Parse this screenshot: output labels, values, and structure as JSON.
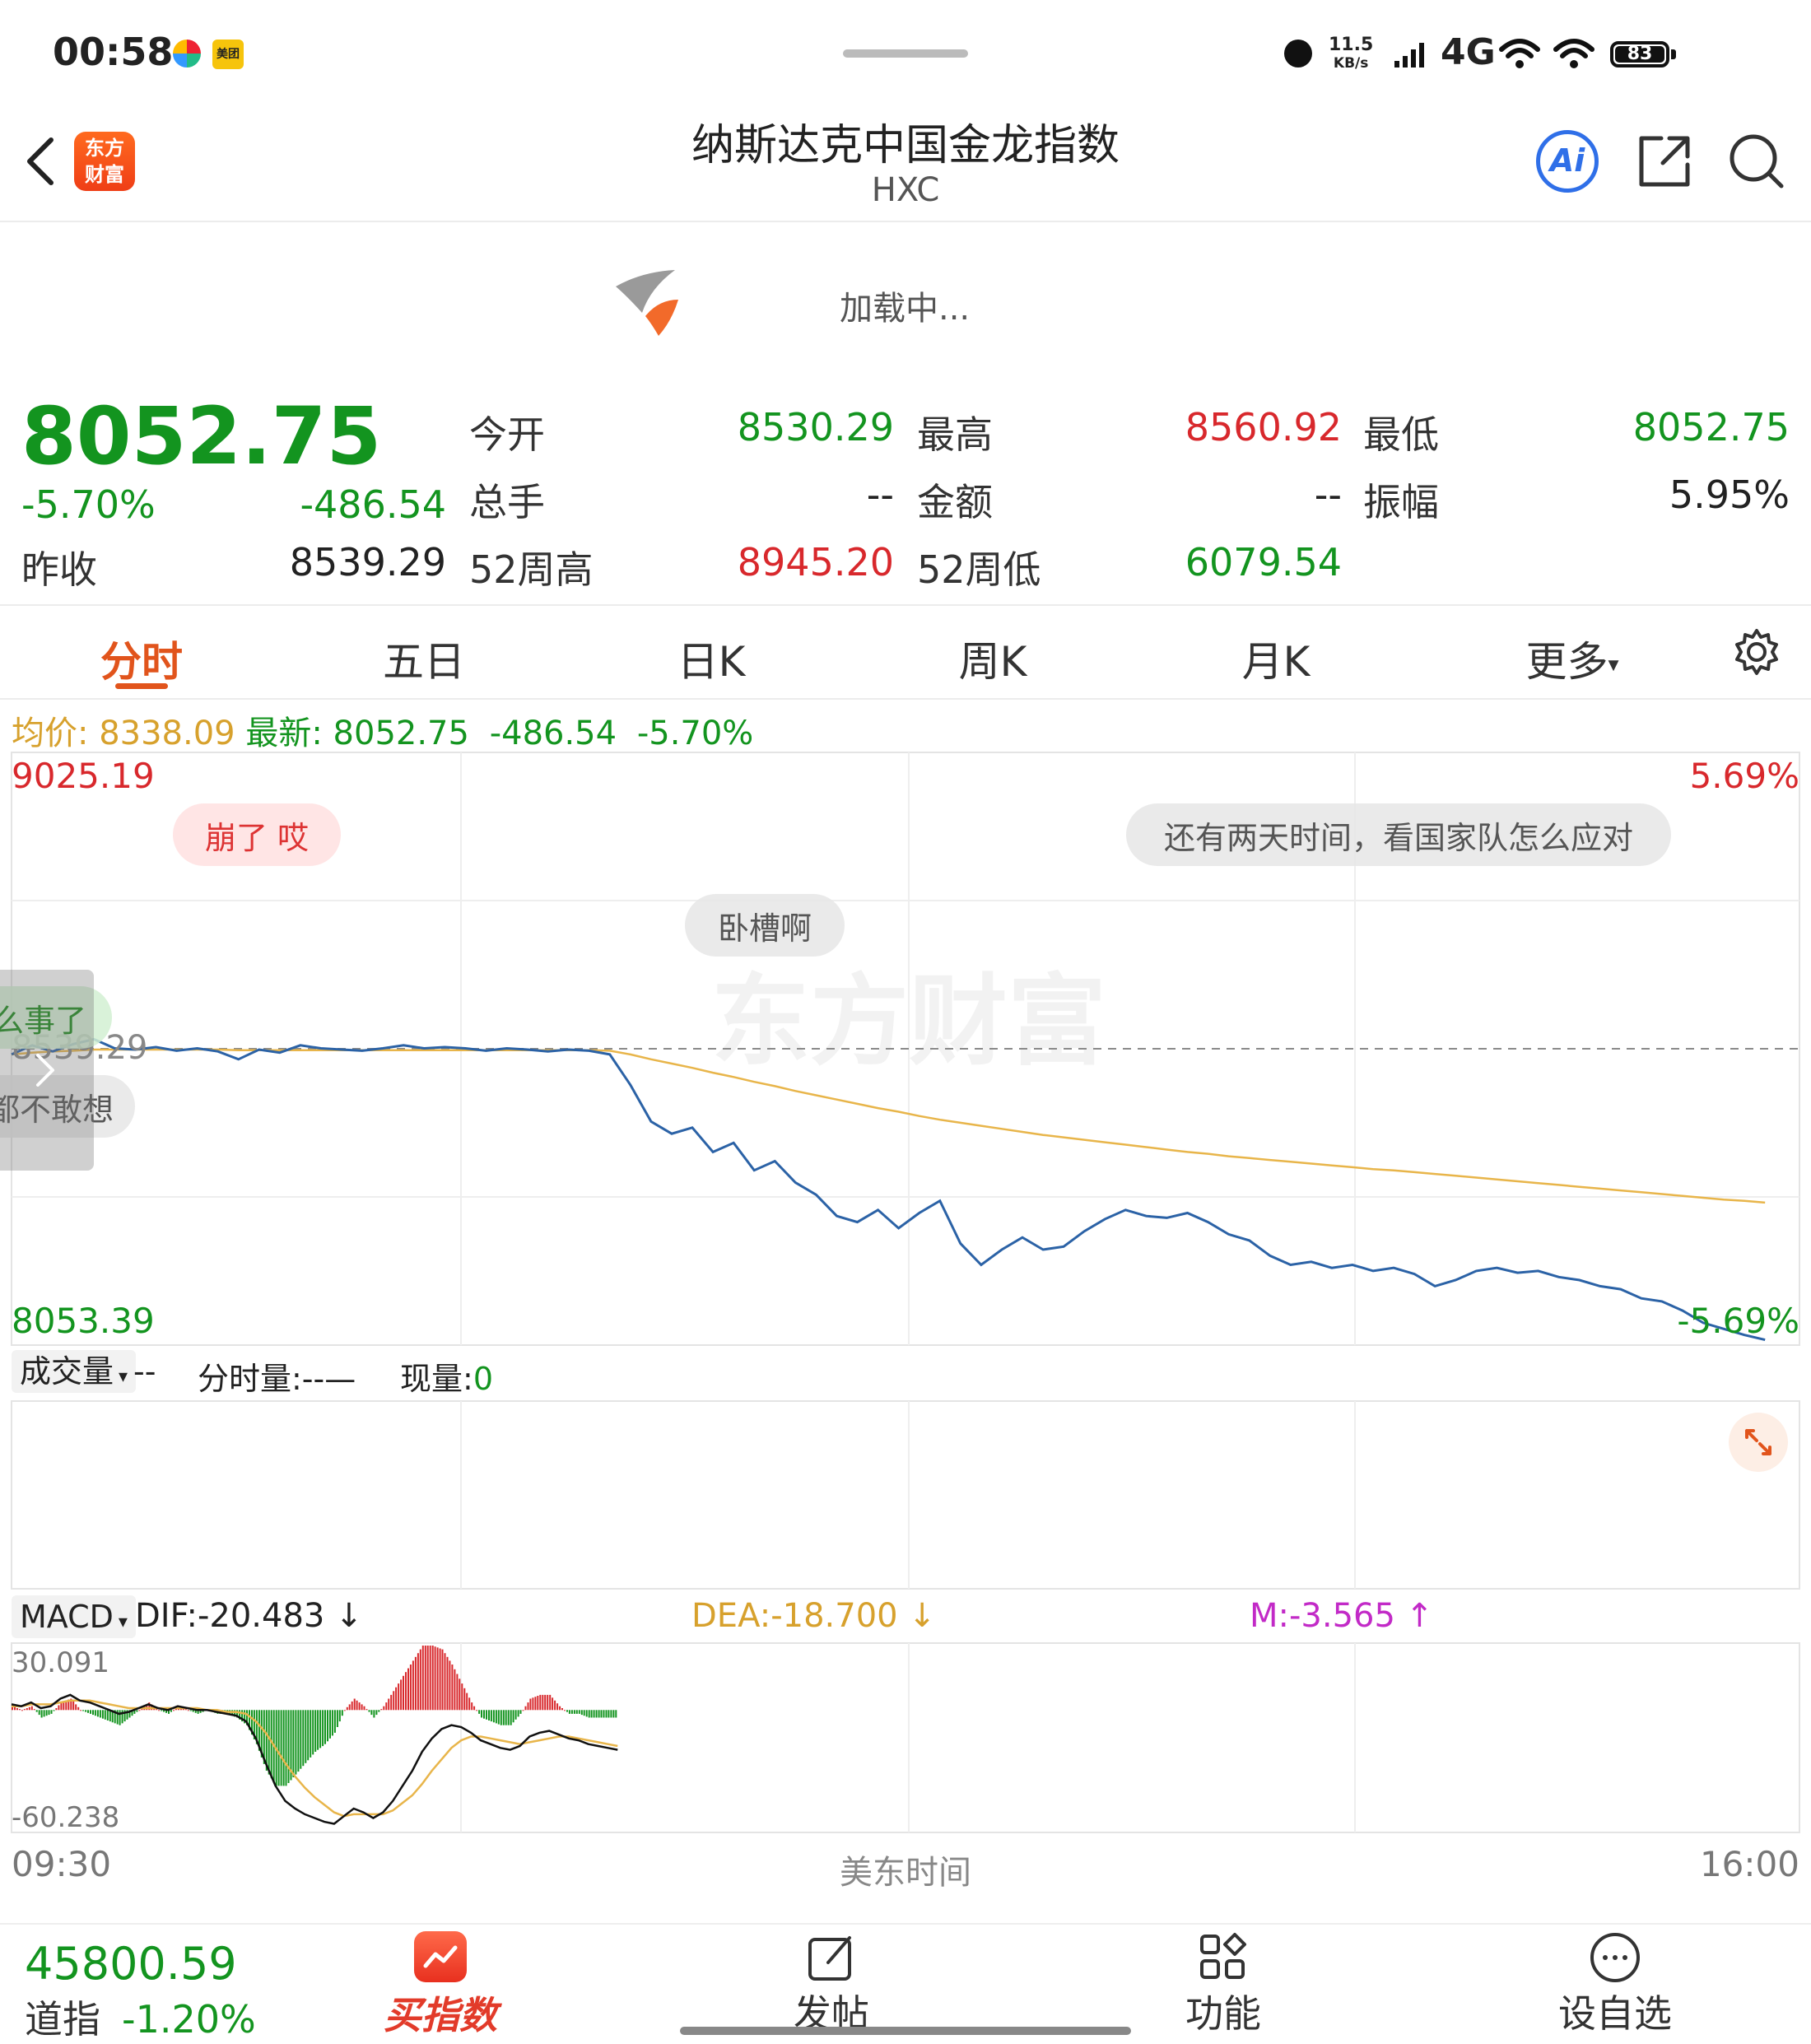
{
  "status": {
    "time": "00:58",
    "net_speed_value": "11.5",
    "net_speed_unit": "KB/s",
    "network": "4G",
    "battery": "83",
    "app_badge_text": "美团"
  },
  "header": {
    "title": "纳斯达克中国金龙指数",
    "subtitle": "HXC",
    "logo_text_1": "东方",
    "logo_text_2": "财富",
    "ai_label": "Ai"
  },
  "loading": {
    "text": "加载中..."
  },
  "quote": {
    "price": "8052.75",
    "change_pct": "-5.70%",
    "change": "-486.54",
    "prev_close_label": "昨收",
    "prev_close": "8539.29",
    "open_label": "今开",
    "open": "8530.29",
    "high_label": "最高",
    "high": "8560.92",
    "low_label": "最低",
    "low": "8052.75",
    "volume_label": "总手",
    "volume": "--",
    "amount_label": "金额",
    "amount": "--",
    "amplitude_label": "振幅",
    "amplitude": "5.95%",
    "wk52_high_label": "52周高",
    "wk52_high": "8945.20",
    "wk52_low_label": "52周低",
    "wk52_low": "6079.54"
  },
  "tabs": [
    {
      "label": "分时",
      "active": true
    },
    {
      "label": "五日"
    },
    {
      "label": "日K"
    },
    {
      "label": "周K"
    },
    {
      "label": "月K"
    },
    {
      "label": "更多"
    }
  ],
  "infoline": {
    "avg_label": "均价:",
    "avg": "8338.09",
    "latest_label": "最新:",
    "latest": "8052.75",
    "change": "-486.54",
    "pct": "-5.70%"
  },
  "chart_data": {
    "type": "line",
    "y_max": "9025.19",
    "y_min": "8053.39",
    "pct_max": "5.69%",
    "pct_min": "-5.69%",
    "ref_label": "8539.29",
    "ylim": [
      8053.39,
      9025.19
    ],
    "ref": 8539.29,
    "watermark": "东方财富",
    "series": [
      {
        "key": "price",
        "color": "#2b62a6",
        "values": [
          8530,
          8545,
          8535,
          8547,
          8555,
          8540,
          8538,
          8542,
          8536,
          8540,
          8535,
          8522,
          8538,
          8533,
          8545,
          8540,
          8538,
          8536,
          8540,
          8545,
          8540,
          8542,
          8540,
          8536,
          8540,
          8538,
          8535,
          8538,
          8536,
          8530,
          8480,
          8420,
          8400,
          8410,
          8370,
          8385,
          8340,
          8355,
          8320,
          8300,
          8265,
          8255,
          8275,
          8245,
          8270,
          8290,
          8220,
          8185,
          8210,
          8230,
          8210,
          8215,
          8240,
          8260,
          8275,
          8265,
          8262,
          8270,
          8255,
          8235,
          8225,
          8200,
          8185,
          8190,
          8180,
          8185,
          8175,
          8180,
          8170,
          8150,
          8160,
          8175,
          8180,
          8172,
          8175,
          8165,
          8160,
          8150,
          8145,
          8130,
          8125,
          8110,
          8090,
          8080,
          8070,
          8062
        ]
      },
      {
        "key": "avg",
        "color": "#e8b54a",
        "values": [
          8530,
          8533,
          8535,
          8536,
          8538,
          8538,
          8538,
          8538,
          8538,
          8538,
          8538,
          8537,
          8537,
          8537,
          8537,
          8537,
          8537,
          8537,
          8537,
          8537,
          8537,
          8537,
          8537,
          8537,
          8537,
          8537,
          8537,
          8537,
          8537,
          8536,
          8530,
          8522,
          8515,
          8508,
          8500,
          8493,
          8485,
          8478,
          8470,
          8463,
          8456,
          8449,
          8442,
          8436,
          8429,
          8423,
          8418,
          8413,
          8408,
          8403,
          8398,
          8394,
          8390,
          8386,
          8382,
          8378,
          8374,
          8370,
          8367,
          8363,
          8360,
          8357,
          8354,
          8351,
          8348,
          8345,
          8342,
          8340,
          8337,
          8334,
          8331,
          8328,
          8325,
          8322,
          8319,
          8316,
          8313,
          8310,
          8307,
          8304,
          8301,
          8298,
          8295,
          8292,
          8290,
          8287
        ]
      }
    ]
  },
  "danmaku": [
    "崩了 哎",
    "还有两天时间，看国家队怎么应对",
    "卧槽啊",
    "么事了",
    "都不敢想"
  ],
  "volume_panel": {
    "selector": "成交量",
    "dash": "--",
    "minute_volume": "分时量:--—",
    "current_label": "现量:",
    "current_value": "0"
  },
  "macd": {
    "selector": "MACD",
    "dif": "DIF:-20.483",
    "dea": "DEA:-18.700",
    "m": "M:-3.565",
    "y_max": "30.091",
    "y_min": "-60.238",
    "ylim": [
      -60.238,
      30.091
    ],
    "dif_values": [
      3,
      2,
      4,
      1,
      2,
      6,
      8,
      5,
      4,
      2,
      0,
      -2,
      -1,
      1,
      3,
      1,
      0,
      2,
      1,
      0,
      0,
      -1,
      -2,
      -3,
      -6,
      -15,
      -28,
      -40,
      -48,
      -52,
      -55,
      -57,
      -59,
      -60,
      -56,
      -52,
      -54,
      -57,
      -54,
      -48,
      -40,
      -32,
      -22,
      -15,
      -10,
      -8,
      -9,
      -12,
      -16,
      -18,
      -20,
      -21,
      -19,
      -14,
      -12,
      -11,
      -13,
      -15,
      -16,
      -18,
      -19,
      -20,
      -21
    ],
    "dea_values": [
      2,
      2,
      3,
      3,
      3,
      4,
      5,
      5,
      5,
      4,
      3,
      2,
      1,
      1,
      1,
      1,
      1,
      1,
      1,
      1,
      0,
      0,
      -1,
      -1,
      -2,
      -6,
      -12,
      -20,
      -28,
      -35,
      -41,
      -46,
      -50,
      -54,
      -56,
      -55,
      -55,
      -55,
      -55,
      -53,
      -49,
      -45,
      -39,
      -32,
      -26,
      -20,
      -16,
      -14,
      -14,
      -15,
      -16,
      -17,
      -18,
      -17,
      -16,
      -15,
      -14,
      -14,
      -15,
      -16,
      -17,
      -18,
      -19
    ]
  },
  "axis": {
    "start": "09:30",
    "middle": "美东时间",
    "end": "16:00"
  },
  "bottom": {
    "index_value": "45800.59",
    "index_name": "道指",
    "index_pct": "-1.20%",
    "buy_label": "买指数",
    "post_label": "发帖",
    "func_label": "功能",
    "watch_label": "设自选"
  }
}
